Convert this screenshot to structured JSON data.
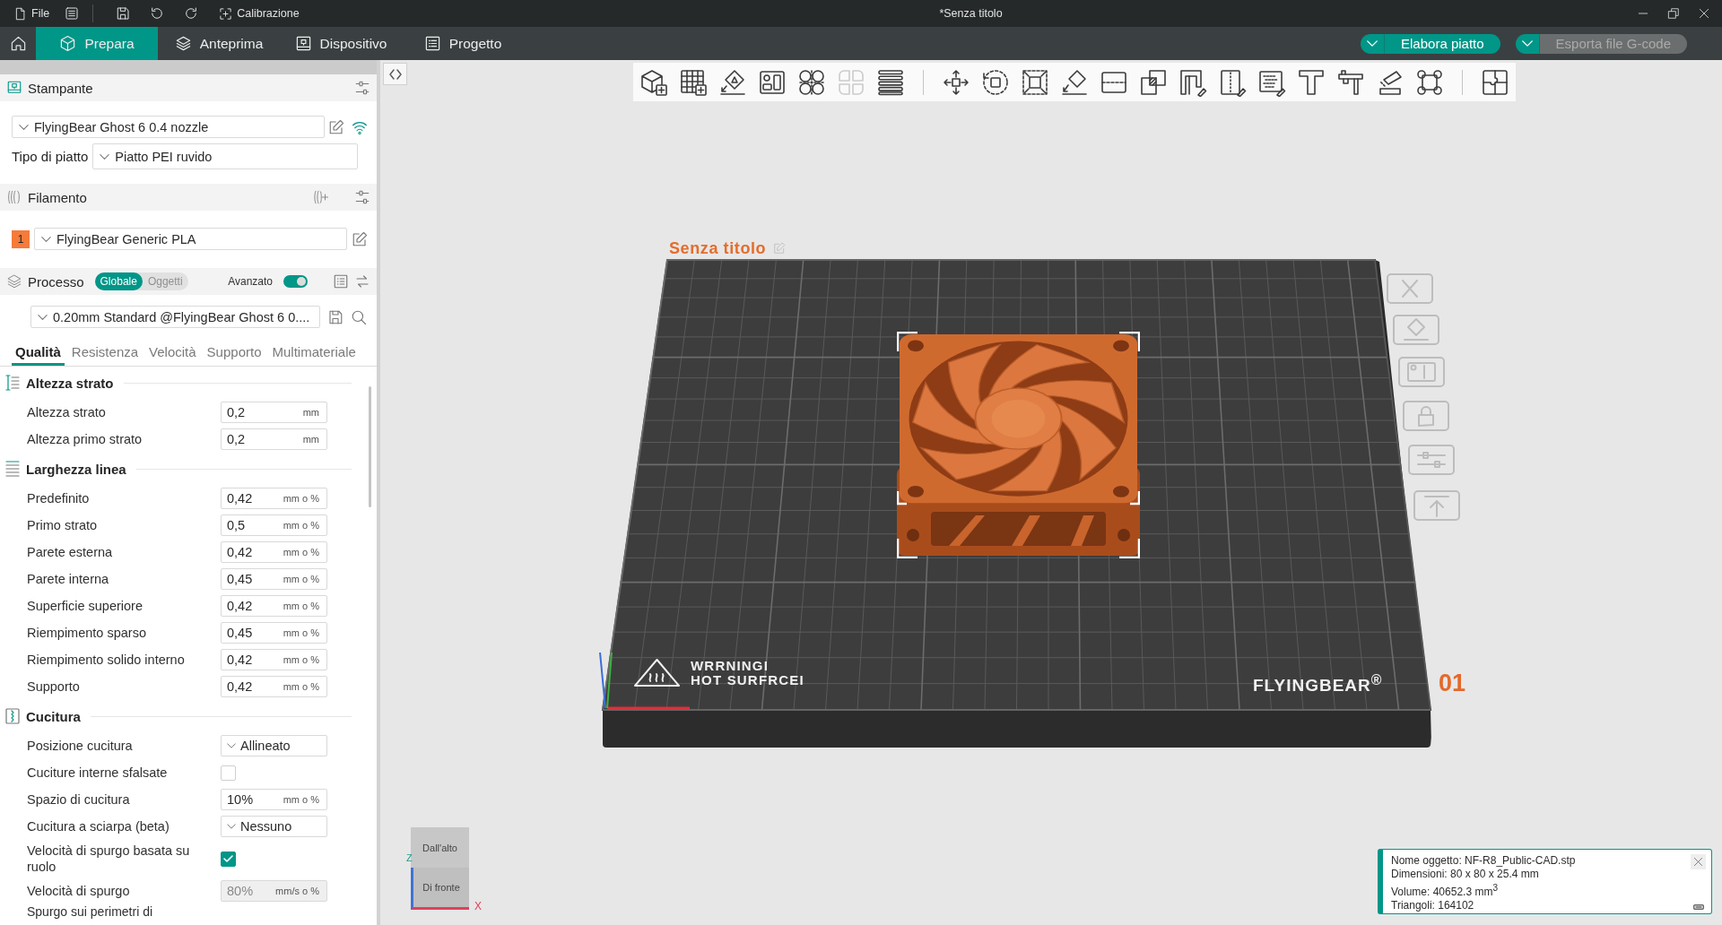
{
  "title_bar": {
    "file_label": "File",
    "calibration_label": "Calibrazione",
    "title": "*Senza titolo"
  },
  "main_tabs": [
    {
      "kind": "prepare",
      "label": "Prepara",
      "selected": true
    },
    {
      "kind": "preview",
      "label": "Anteprima",
      "selected": false
    },
    {
      "kind": "device",
      "label": "Dispositivo",
      "selected": false
    },
    {
      "kind": "project",
      "label": "Progetto",
      "selected": false
    }
  ],
  "actions": [
    {
      "label": "Elabora piatto",
      "disabled": false
    },
    {
      "label": "Esporta file G-code",
      "disabled": true
    }
  ],
  "sidebar": {
    "printer": {
      "title": "Stampante",
      "preset": "FlyingBear Ghost 6 0.4 nozzle",
      "plate_type_label": "Tipo di piatto",
      "plate_type": "Piatto PEI ruvido"
    },
    "filament": {
      "title": "Filamento",
      "slots": [
        {
          "number": "1",
          "color": "#f57b3b",
          "name": "FlyingBear Generic PLA"
        }
      ]
    },
    "process": {
      "title": "Processo",
      "scope": [
        {
          "label": "Globale",
          "selected": true
        },
        {
          "label": "Oggetti",
          "selected": false
        }
      ],
      "advanced_label": "Avanzato",
      "advanced_on": true,
      "preset": "0.20mm Standard @FlyingBear Ghost 6 0....",
      "tabs": [
        {
          "label": "Qualità",
          "selected": true
        },
        {
          "label": "Resistenza",
          "selected": false
        },
        {
          "label": "Velocità",
          "selected": false
        },
        {
          "label": "Supporto",
          "selected": false
        },
        {
          "label": "Multimateriale",
          "selected": false
        }
      ]
    },
    "groups": [
      {
        "kind": "layer",
        "title": "Altezza strato",
        "rows": [
          {
            "kind": "number",
            "label": "Altezza strato",
            "value": "0,2",
            "unit": "mm",
            "disabled": false
          },
          {
            "kind": "number",
            "label": "Altezza primo strato",
            "value": "0,2",
            "unit": "mm",
            "disabled": false
          }
        ]
      },
      {
        "kind": "width",
        "title": "Larghezza linea",
        "rows": [
          {
            "kind": "number",
            "label": "Predefinito",
            "value": "0,42",
            "unit": "mm o %",
            "disabled": false
          },
          {
            "kind": "number",
            "label": "Primo strato",
            "value": "0,5",
            "unit": "mm o %",
            "disabled": false
          },
          {
            "kind": "number",
            "label": "Parete esterna",
            "value": "0,42",
            "unit": "mm o %",
            "disabled": false
          },
          {
            "kind": "number",
            "label": "Parete interna",
            "value": "0,45",
            "unit": "mm o %",
            "disabled": false
          },
          {
            "kind": "number",
            "label": "Superficie superiore",
            "value": "0,42",
            "unit": "mm o %",
            "disabled": false
          },
          {
            "kind": "number",
            "label": "Riempimento sparso",
            "value": "0,45",
            "unit": "mm o %",
            "disabled": false
          },
          {
            "kind": "number",
            "label": "Riempimento solido interno",
            "value": "0,42",
            "unit": "mm o %",
            "disabled": false
          },
          {
            "kind": "number",
            "label": "Supporto",
            "value": "0,42",
            "unit": "mm o %",
            "disabled": false
          }
        ]
      },
      {
        "kind": "seam",
        "title": "Cucitura",
        "rows": [
          {
            "kind": "select",
            "label": "Posizione cucitura",
            "value": "Allineato",
            "disabled": false
          },
          {
            "kind": "checkbox",
            "label": "Cuciture interne sfalsate",
            "checked": false,
            "disabled": false
          },
          {
            "kind": "number",
            "label": "Spazio di cucitura",
            "value": "10%",
            "unit": "mm o %",
            "disabled": false
          },
          {
            "kind": "select",
            "label": "Cucitura a sciarpa (beta)",
            "value": "Nessuno",
            "disabled": false
          },
          {
            "kind": "checkbox",
            "label": "Velocità di spurgo basata su ruolo",
            "checked": true,
            "disabled": false
          },
          {
            "kind": "number",
            "label": "Velocità di spurgo",
            "value": "80%",
            "unit": "mm/s o %",
            "disabled": true
          },
          {
            "kind": "cut",
            "label": "Spurgo sui perimetri di"
          }
        ]
      }
    ]
  },
  "viewport": {
    "toolbar": [
      [
        {
          "kind": "cube-add",
          "disabled": false
        },
        {
          "kind": "grid-add",
          "disabled": false
        },
        {
          "kind": "orient",
          "disabled": false
        },
        {
          "kind": "arrange",
          "disabled": false
        },
        {
          "kind": "split-objects",
          "disabled": false
        },
        {
          "kind": "split-parts",
          "disabled": true
        },
        {
          "kind": "layers",
          "disabled": false
        }
      ],
      [
        {
          "kind": "move",
          "disabled": false
        },
        {
          "kind": "rotate",
          "disabled": false
        },
        {
          "kind": "scale",
          "disabled": false
        },
        {
          "kind": "lay-flat",
          "disabled": false
        },
        {
          "kind": "cut",
          "disabled": false
        },
        {
          "kind": "boolean",
          "disabled": false
        },
        {
          "kind": "support-paint",
          "disabled": false
        },
        {
          "kind": "seam-paint",
          "disabled": false
        },
        {
          "kind": "fuzzy-paint",
          "disabled": false
        },
        {
          "kind": "text",
          "disabled": false
        },
        {
          "kind": "measure",
          "disabled": false
        },
        {
          "kind": "assembly",
          "disabled": false
        },
        {
          "kind": "brim-ears",
          "disabled": false
        }
      ],
      [
        {
          "kind": "puzzle",
          "disabled": false
        }
      ]
    ],
    "plate": {
      "label": "Senza titolo",
      "warning": [
        "WRRNINGI",
        "HOT SURFRCEI"
      ],
      "brand": "FLYINGBEAR$^{®}$",
      "number": "01"
    },
    "object": {
      "selected": true
    },
    "view_cube": {
      "top": "Dall'alto",
      "front": "Di fronte",
      "axis_z": "Z",
      "axis_x": "X"
    },
    "object_info": [
      "Nome oggetto: NF-R8_Public-CAD.stp",
      "Dimensioni: 80 x 80 x 25.4 mm",
      "Volume: 40652.3 mm$^{3}$",
      "Triangoli: 164102"
    ]
  }
}
